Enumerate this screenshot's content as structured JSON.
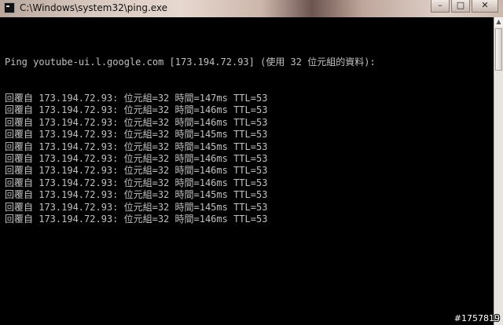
{
  "window": {
    "title": "C:\\Windows\\system32\\ping.exe",
    "controls": {
      "minimize": "–",
      "maximize": "□",
      "close": "✕"
    },
    "icon": "console-icon"
  },
  "console": {
    "header": "Ping youtube-ui.l.google.com [173.194.72.93] (使用 32 位元組的資料):",
    "lines": [
      "回覆自 173.194.72.93: 位元組=32 時間=147ms TTL=53",
      "回覆自 173.194.72.93: 位元組=32 時間=146ms TTL=53",
      "回覆自 173.194.72.93: 位元組=32 時間=146ms TTL=53",
      "回覆自 173.194.72.93: 位元組=32 時間=145ms TTL=53",
      "回覆自 173.194.72.93: 位元組=32 時間=145ms TTL=53",
      "回覆自 173.194.72.93: 位元組=32 時間=146ms TTL=53",
      "回覆自 173.194.72.93: 位元組=32 時間=146ms TTL=53",
      "回覆自 173.194.72.93: 位元組=32 時間=146ms TTL=53",
      "回覆自 173.194.72.93: 位元組=32 時間=145ms TTL=53",
      "回覆自 173.194.72.93: 位元組=32 時間=145ms TTL=53",
      "回覆自 173.194.72.93: 位元組=32 時間=146ms TTL=53"
    ],
    "colors": {
      "background": "#000000",
      "text": "#c0c0c0"
    }
  },
  "watermark": "#1757819"
}
